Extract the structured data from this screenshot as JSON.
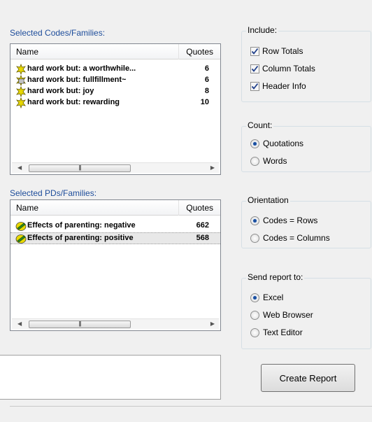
{
  "codes": {
    "label": "Selected Codes/Families:",
    "columns": {
      "name": "Name",
      "quotes": "Quotes"
    },
    "rows": [
      {
        "name": "hard work but: a worthwhile...",
        "quotes": "6",
        "icon": "code-icon"
      },
      {
        "name": "hard work but: fullfillment~",
        "quotes": "6",
        "icon": "code-comment-icon"
      },
      {
        "name": "hard work but: joy",
        "quotes": "8",
        "icon": "code-icon"
      },
      {
        "name": "hard work but: rewarding",
        "quotes": "10",
        "icon": "code-icon"
      }
    ]
  },
  "pds": {
    "label": "Selected PDs/Families:",
    "columns": {
      "name": "Name",
      "quotes": "Quotes"
    },
    "rows": [
      {
        "name": "Effects of parenting: negative",
        "quotes": "662",
        "icon": "family-icon"
      },
      {
        "name": "Effects of parenting: positive",
        "quotes": "568",
        "icon": "family-icon"
      }
    ]
  },
  "include": {
    "title": "Include:",
    "options": [
      {
        "label": "Row Totals",
        "checked": true
      },
      {
        "label": "Column Totals",
        "checked": true
      },
      {
        "label": "Header Info",
        "checked": true
      }
    ]
  },
  "count": {
    "title": "Count:",
    "options": [
      {
        "label": "Quotations",
        "selected": true
      },
      {
        "label": "Words",
        "selected": false
      }
    ]
  },
  "orientation": {
    "title": "Orientation",
    "options": [
      {
        "label": "Codes = Rows",
        "selected": true
      },
      {
        "label": "Codes = Columns",
        "selected": false
      }
    ]
  },
  "send": {
    "title": "Send report to:",
    "options": [
      {
        "label": "Excel",
        "selected": true
      },
      {
        "label": "Web Browser",
        "selected": false
      },
      {
        "label": "Text Editor",
        "selected": false
      }
    ]
  },
  "create_button": "Create Report",
  "colors": {
    "accent_label": "#1e4d9b",
    "radio_dot": "#1a4fa0",
    "code_icon": "#e8d800",
    "family_icon": "#2a8a1e"
  }
}
